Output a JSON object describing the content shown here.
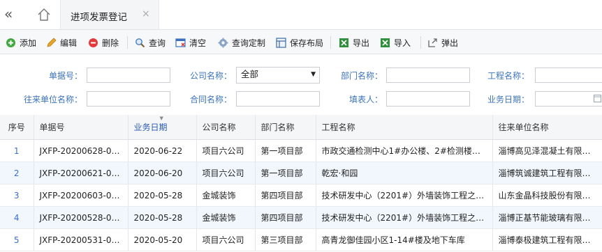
{
  "tabbar": {
    "tab_label": "进项发票登记",
    "close_glyph": "×",
    "collapse_glyph": "«"
  },
  "toolbar": {
    "buttons": [
      {
        "label": "添加",
        "icon": "add-circle-icon"
      },
      {
        "label": "编辑",
        "icon": "pencil-icon"
      },
      {
        "label": "删除",
        "icon": "delete-circle-icon"
      },
      {
        "label": "查询",
        "icon": "search-icon"
      },
      {
        "label": "清空",
        "icon": "clear-icon"
      },
      {
        "label": "查询定制",
        "icon": "gear-icon"
      },
      {
        "label": "保存布局",
        "icon": "layout-icon"
      },
      {
        "label": "导出",
        "icon": "excel-export-icon"
      },
      {
        "label": "导入",
        "icon": "excel-import-icon"
      },
      {
        "label": "弹出",
        "icon": "popout-icon"
      }
    ]
  },
  "form": {
    "bill_no_label": "单据号：",
    "bill_no_value": "",
    "company_label": "公司名称：",
    "company_value": "全部",
    "dept_label": "部门名称：",
    "dept_value": "",
    "project_label": "工程名称：",
    "project_value": "",
    "partner_label": "往来单位名称：",
    "partner_value": "",
    "contract_label": "合同名称：",
    "contract_value": "",
    "filler_label": "填表人：",
    "filler_value": "",
    "bizdate_label": "业务日期：",
    "bizdate_value": ""
  },
  "table": {
    "columns": [
      "序号",
      "单据号",
      "业务日期",
      "公司名称",
      "部门名称",
      "工程名称",
      "往来单位名称"
    ],
    "rows": [
      [
        "1",
        "JXFP-20200628-001",
        "2020-06-22",
        "项目六公司",
        "第一项目部",
        "市政交通检测中心1#办公楼、2#检测楼、…",
        "淄博高见泽混凝土有限…"
      ],
      [
        "2",
        "JXFP-20200621-001",
        "2020-06-20",
        "项目六公司",
        "第一项目部",
        "乾宏·和园",
        "淄博筑诚建筑工程有限…"
      ],
      [
        "3",
        "JXFP-20200603-001",
        "2020-05-28",
        "金城装饰",
        "第四项目部",
        "技术研发中心（2201#）外墙装饰工程之…",
        "山东金晶科技股份有限…"
      ],
      [
        "4",
        "JXFP-20200528-001",
        "2020-05-28",
        "金城装饰",
        "第四项目部",
        "技术研发中心（2201#）外墙装饰工程之…",
        "淄博正基节能玻璃有限…"
      ],
      [
        "5",
        "JXFP-20200531-001",
        "2020-05-20",
        "项目六公司",
        "第三项目部",
        "高青龙御佳园小区1-14#楼及地下车库",
        "淄博泰极建筑工程有限…"
      ]
    ]
  }
}
